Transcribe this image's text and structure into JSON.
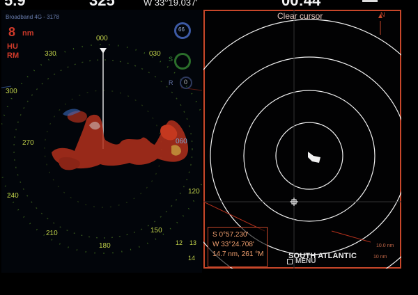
{
  "top_bar": {
    "value_left": "5.9",
    "value_center": "325",
    "longitude": "W  33°19.037'",
    "value_right": "00:44"
  },
  "radar": {
    "source": "Broadband 4G - 3178",
    "range_value": "8",
    "range_unit": "nm",
    "orientation": "HU",
    "motion": "RM",
    "heading_marker": "000",
    "bearings": [
      "330",
      "030",
      "300",
      "270",
      "240",
      "210",
      "180",
      "150",
      "120",
      "060"
    ],
    "gain_badge": "66",
    "sea_badge": "S",
    "rain_label": "R",
    "rain_value": "0",
    "minor_ring_labels": [
      "12",
      "13",
      "14"
    ]
  },
  "chart": {
    "clear_cursor_label": "Clear cursor",
    "north_indicator": "N",
    "cursor_lat": "S  0°57.230'",
    "cursor_lon": "W  33°24.708'",
    "cursor_range_bearing": "14.7 nm, 261 °M",
    "region_label": "SOUTH ATLANTIC",
    "menu_label": "MENU",
    "scale_top": "10.0 nm",
    "scale_bottom": "10 nm",
    "colors": {
      "frame": "#c8472a",
      "rings": "#ffffff",
      "echo": "#b3301c"
    }
  }
}
